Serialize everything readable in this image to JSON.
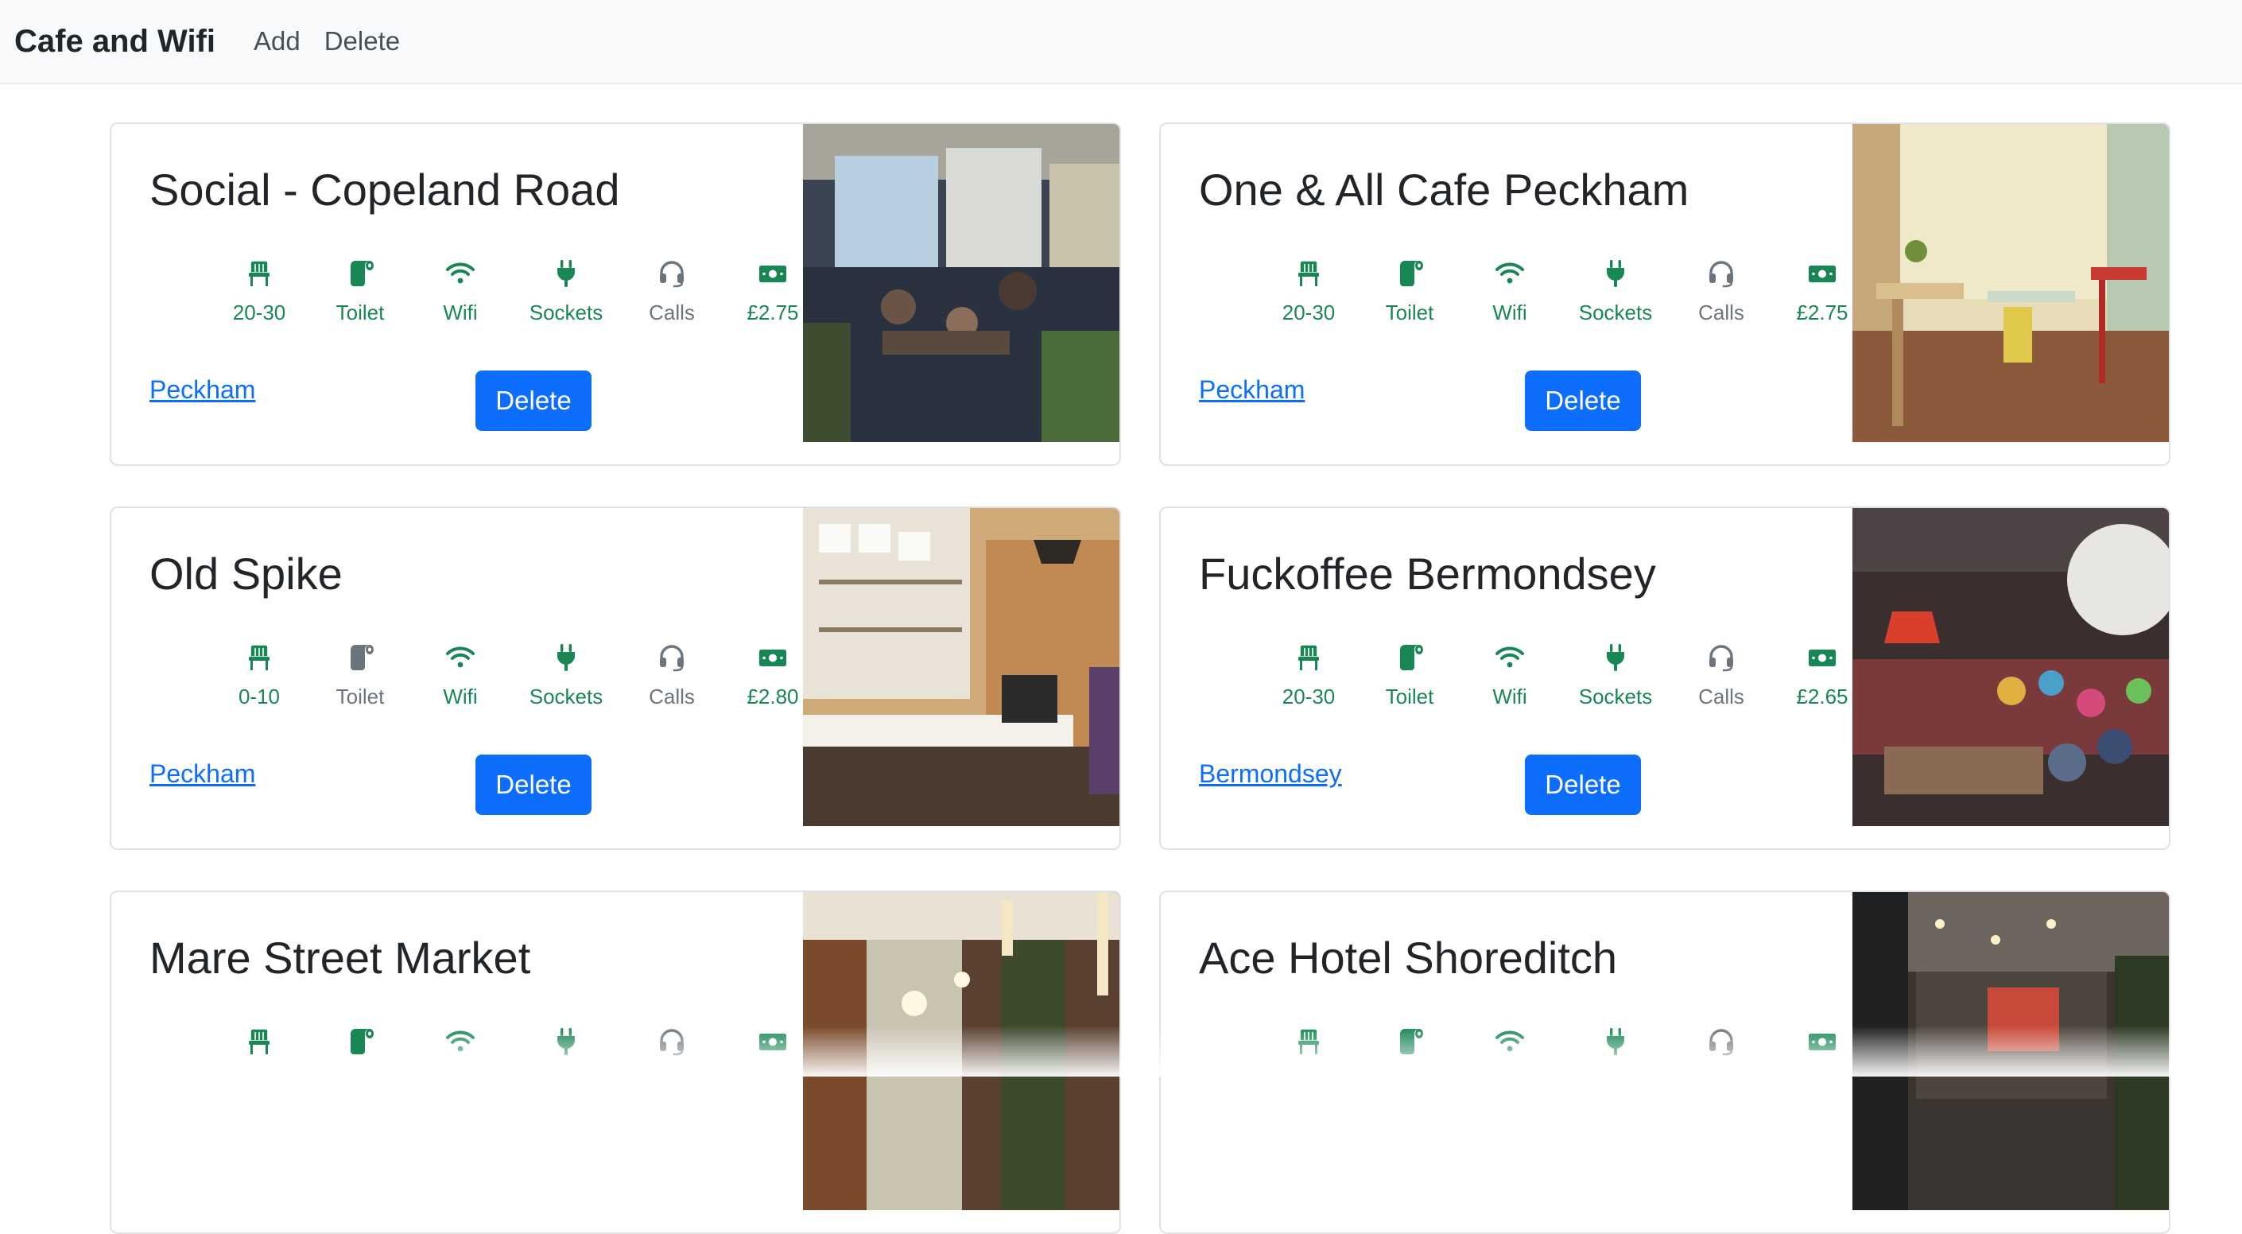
{
  "nav": {
    "brand": "Cafe and Wifi",
    "add": "Add",
    "delete": "Delete"
  },
  "colors": {
    "on": "#198754",
    "off": "#6c757d",
    "button": "#0d6efd"
  },
  "cafes": [
    {
      "name": "Social - Copeland Road",
      "location": "Peckham",
      "delete_label": "Delete",
      "image": "cafe-interior-photo",
      "amenities": [
        {
          "icon": "chair-icon",
          "label": "20-30",
          "active": true
        },
        {
          "icon": "toilet-icon",
          "label": "Toilet",
          "active": true
        },
        {
          "icon": "wifi-icon",
          "label": "Wifi",
          "active": true
        },
        {
          "icon": "plug-icon",
          "label": "Sockets",
          "active": true
        },
        {
          "icon": "headset-icon",
          "label": "Calls",
          "active": false
        },
        {
          "icon": "money-icon",
          "label": "£2.75",
          "active": true
        }
      ]
    },
    {
      "name": "One & All Cafe Peckham",
      "location": "Peckham",
      "delete_label": "Delete",
      "image": "cafe-interior-photo",
      "amenities": [
        {
          "icon": "chair-icon",
          "label": "20-30",
          "active": true
        },
        {
          "icon": "toilet-icon",
          "label": "Toilet",
          "active": true
        },
        {
          "icon": "wifi-icon",
          "label": "Wifi",
          "active": true
        },
        {
          "icon": "plug-icon",
          "label": "Sockets",
          "active": true
        },
        {
          "icon": "headset-icon",
          "label": "Calls",
          "active": false
        },
        {
          "icon": "money-icon",
          "label": "£2.75",
          "active": true
        }
      ]
    },
    {
      "name": "Old Spike",
      "location": "Peckham",
      "delete_label": "Delete",
      "image": "cafe-counter-photo",
      "amenities": [
        {
          "icon": "chair-icon",
          "label": "0-10",
          "active": true
        },
        {
          "icon": "toilet-icon",
          "label": "Toilet",
          "active": false
        },
        {
          "icon": "wifi-icon",
          "label": "Wifi",
          "active": true
        },
        {
          "icon": "plug-icon",
          "label": "Sockets",
          "active": true
        },
        {
          "icon": "headset-icon",
          "label": "Calls",
          "active": false
        },
        {
          "icon": "money-icon",
          "label": "£2.80",
          "active": true
        }
      ]
    },
    {
      "name": "Fuckoffee Bermondsey",
      "location": "Bermondsey",
      "delete_label": "Delete",
      "image": "cafe-interior-photo",
      "amenities": [
        {
          "icon": "chair-icon",
          "label": "20-30",
          "active": true
        },
        {
          "icon": "toilet-icon",
          "label": "Toilet",
          "active": true
        },
        {
          "icon": "wifi-icon",
          "label": "Wifi",
          "active": true
        },
        {
          "icon": "plug-icon",
          "label": "Sockets",
          "active": true
        },
        {
          "icon": "headset-icon",
          "label": "Calls",
          "active": false
        },
        {
          "icon": "money-icon",
          "label": "£2.65",
          "active": true
        }
      ]
    },
    {
      "name": "Mare Street Market",
      "image": "market-hall-photo",
      "amenities": [
        {
          "icon": "chair-icon",
          "active": true
        },
        {
          "icon": "toilet-icon",
          "active": true
        },
        {
          "icon": "wifi-icon",
          "active": true
        },
        {
          "icon": "plug-icon",
          "active": true
        },
        {
          "icon": "headset-icon",
          "active": false
        },
        {
          "icon": "money-icon",
          "active": true
        }
      ]
    },
    {
      "name": "Ace Hotel Shoreditch",
      "image": "hotel-lobby-photo",
      "amenities": [
        {
          "icon": "chair-icon",
          "active": true
        },
        {
          "icon": "toilet-icon",
          "active": true
        },
        {
          "icon": "wifi-icon",
          "active": true
        },
        {
          "icon": "plug-icon",
          "active": true
        },
        {
          "icon": "headset-icon",
          "active": false
        },
        {
          "icon": "money-icon",
          "active": true
        }
      ]
    }
  ]
}
